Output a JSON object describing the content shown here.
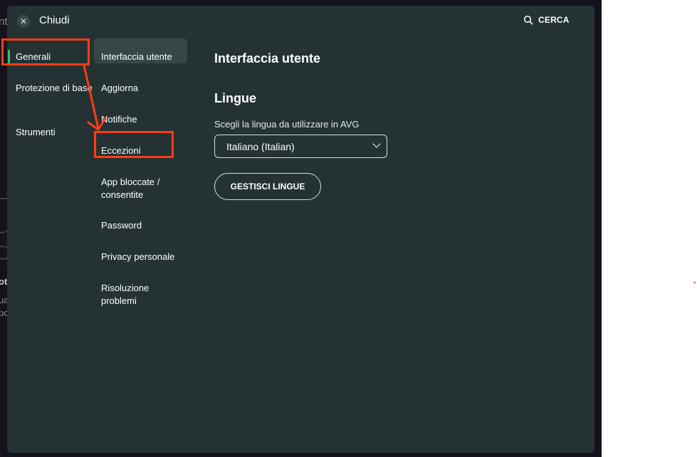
{
  "header": {
    "close_label": "Chiudi",
    "search_label": "CERCA"
  },
  "background": {
    "fragment_1": "nt",
    "fragment_2": "ot",
    "fragment_3": "ua",
    "fragment_4": "po"
  },
  "categories": [
    {
      "label": "Generali",
      "active": true
    },
    {
      "label": "Protezione di base",
      "active": false
    },
    {
      "label": "Strumenti",
      "active": false
    }
  ],
  "subsections": [
    {
      "label": "Interfaccia utente",
      "active": true
    },
    {
      "label": "Aggiorna",
      "active": false
    },
    {
      "label": "Notifiche",
      "active": false
    },
    {
      "label": "Eccezioni",
      "active": false
    },
    {
      "label": "App bloccate / consentite",
      "active": false
    },
    {
      "label": "Password",
      "active": false
    },
    {
      "label": "Privacy personale",
      "active": false
    },
    {
      "label": "Risoluzione problemi",
      "active": false
    }
  ],
  "content": {
    "title": "Interfaccia utente",
    "section_title": "Lingue",
    "language_label": "Scegli la lingua da utilizzare in AVG",
    "language_value": "Italiano (Italian)",
    "manage_button": "GESTISCI LINGUE"
  },
  "colors": {
    "dialog_bg": "#253233",
    "active_item_bg": "#374547",
    "annotation": "#ff3c14"
  }
}
